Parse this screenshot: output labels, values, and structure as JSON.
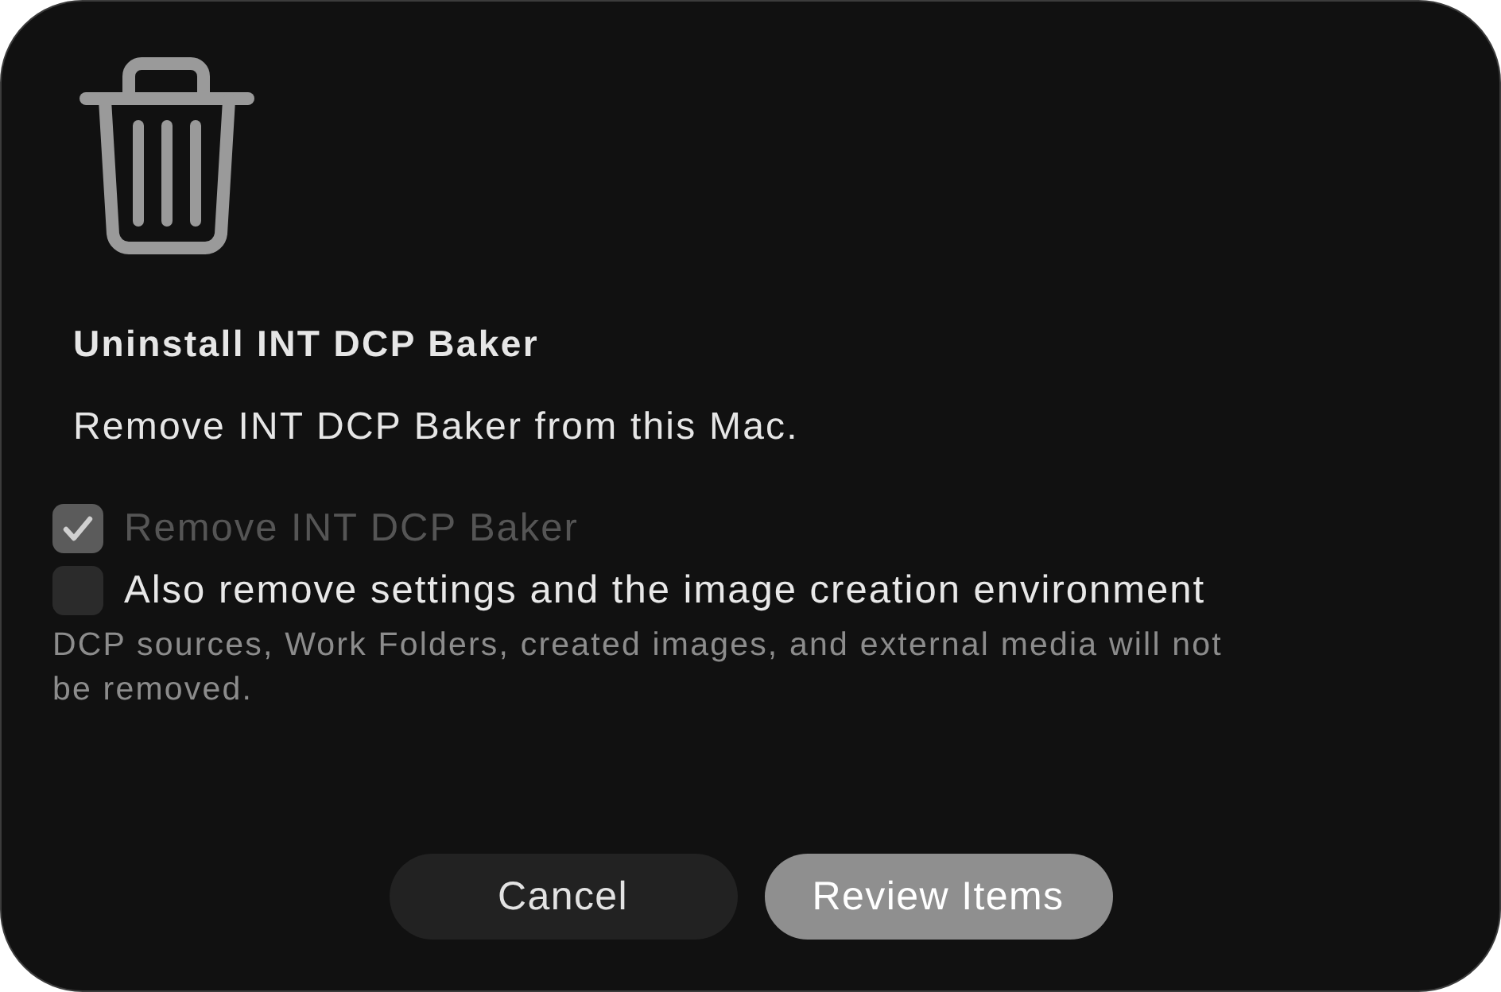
{
  "dialog": {
    "title": "Uninstall INT DCP Baker",
    "message": "Remove INT DCP Baker from this Mac.",
    "options": [
      {
        "label": "Remove INT DCP Baker",
        "checked": true,
        "disabled": true
      },
      {
        "label": "Also remove settings and the image creation environment",
        "checked": false,
        "disabled": false
      }
    ],
    "note": "DCP sources, Work Folders, created images, and external media will not be removed.",
    "buttons": [
      {
        "label": "Cancel",
        "kind": "secondary"
      },
      {
        "label": "Review Items",
        "kind": "primary"
      }
    ]
  }
}
